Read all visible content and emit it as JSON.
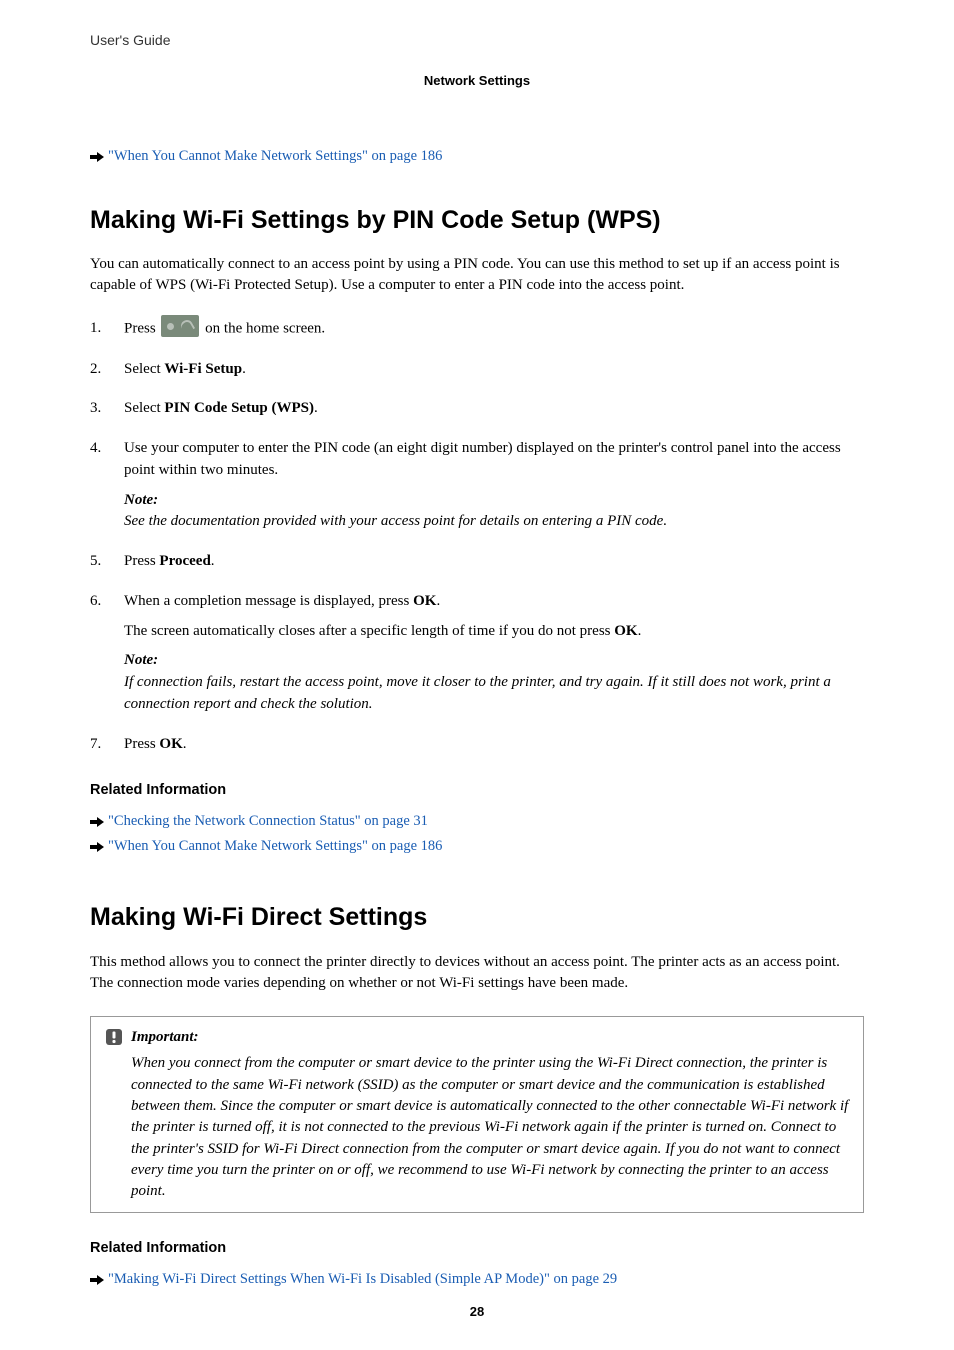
{
  "header": {
    "left": "User's Guide",
    "center": "Network Settings"
  },
  "topLink": "\"When You Cannot Make Network Settings\" on page 186",
  "section1": {
    "heading": "Making Wi-Fi Settings by PIN Code Setup (WPS)",
    "intro": "You can automatically connect to an access point by using a PIN code. You can use this method to set up if an access point is capable of WPS (Wi-Fi Protected Setup). Use a computer to enter a PIN code into the access point.",
    "step1_a": "Press ",
    "step1_b": " on the home screen.",
    "step2_a": "Select ",
    "step2_strong": "Wi-Fi Setup",
    "step2_b": ".",
    "step3_a": "Select ",
    "step3_strong": "PIN Code Setup (WPS)",
    "step3_b": ".",
    "step4": "Use your computer to enter the PIN code (an eight digit number) displayed on the printer's control panel into the access point within two minutes.",
    "note1_label": "Note:",
    "note1_text": "See the documentation provided with your access point for details on entering a PIN code.",
    "step5_a": "Press ",
    "step5_strong": "Proceed",
    "step5_b": ".",
    "step6_a": "When a completion message is displayed, press ",
    "step6_strong": "OK",
    "step6_b": ".",
    "step6_sub_a": "The screen automatically closes after a specific length of time if you do not press ",
    "step6_sub_strong": "OK",
    "step6_sub_b": ".",
    "note2_label": "Note:",
    "note2_text": "If connection fails, restart the access point, move it closer to the printer, and try again. If it still does not work, print a connection report and check the solution.",
    "step7_a": "Press ",
    "step7_strong": "OK",
    "step7_b": ".",
    "related_heading": "Related Information",
    "related_link1": "\"Checking the Network Connection Status\" on page 31",
    "related_link2": "\"When You Cannot Make Network Settings\" on page 186"
  },
  "section2": {
    "heading": "Making Wi-Fi Direct Settings",
    "intro": "This method allows you to connect the printer directly to devices without an access point. The printer acts as an access point. The connection mode varies depending on whether or not Wi-Fi settings have been made.",
    "important_label": "Important:",
    "important_body": "When you connect from the computer or smart device to the printer using the Wi-Fi Direct connection, the printer is connected to the same Wi-Fi network (SSID) as the computer or smart device and the communication is established between them. Since the computer or smart device is automatically connected to the other connectable Wi-Fi network if the printer is turned off, it is not connected to the previous Wi-Fi network again if the printer is turned on. Connect to the printer's SSID for Wi-Fi Direct connection from the computer or smart device again. If you do not want to connect every time you turn the printer on or off, we recommend to use Wi-Fi network by connecting the printer to an access point.",
    "related_heading": "Related Information",
    "related_link1": "\"Making Wi-Fi Direct Settings When Wi-Fi Is Disabled (Simple AP Mode)\" on page 29"
  },
  "pageNumber": "28"
}
